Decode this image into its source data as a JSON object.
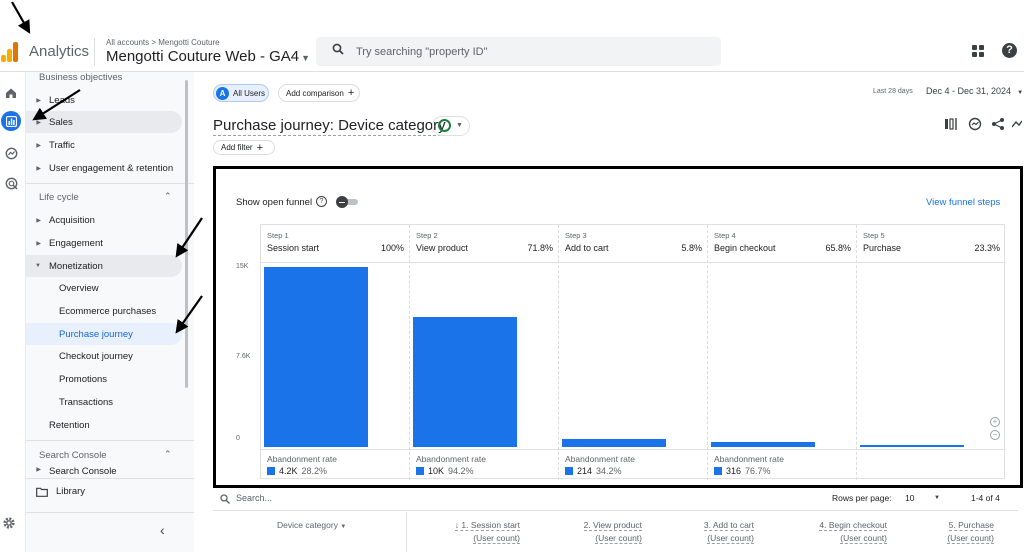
{
  "app": {
    "name": "Analytics",
    "breadcrumb": "All accounts > Mengotti Couture",
    "property": "Mengotti Couture Web - GA4"
  },
  "search": {
    "placeholder": "Try searching \"property ID\""
  },
  "sidebar": {
    "business_objectives": "Business objectives",
    "bo_items": [
      "Leads",
      "Sales",
      "Traffic",
      "User engagement & retention"
    ],
    "life_cycle": "Life cycle",
    "lc_items": [
      "Acquisition",
      "Engagement",
      "Monetization"
    ],
    "monetization_sub": [
      "Overview",
      "Ecommerce purchases",
      "Purchase journey",
      "Checkout journey",
      "Promotions",
      "Transactions"
    ],
    "retention": "Retention",
    "search_console": "Search Console",
    "search_console_sub": "Search Console",
    "library": "Library"
  },
  "toolbar": {
    "segment": "All Users",
    "segment_letter": "A",
    "add_comparison": "Add comparison",
    "date_label": "Last 28 days",
    "date_range": "Dec 4 - Dec 31, 2024"
  },
  "page": {
    "title": "Purchase journey: Device category",
    "add_filter": "Add filter"
  },
  "funnel": {
    "show_open_funnel": "Show open funnel",
    "view_steps": "View funnel steps",
    "abandonment_label": "Abandonment rate",
    "y_ticks": [
      "15K",
      "7.6K",
      "0"
    ]
  },
  "chart_data": {
    "type": "bar",
    "categories": [
      "Session start",
      "View product",
      "Add to cart",
      "Begin checkout",
      "Purchase"
    ],
    "step_labels": [
      "Step 1",
      "Step 2",
      "Step 3",
      "Step 4",
      "Step 5"
    ],
    "step_percents": [
      "100%",
      "71.8%",
      "5.8%",
      "65.8%",
      "23.3%"
    ],
    "values": [
      14900,
      10700,
      650,
      430,
      100
    ],
    "ylim": [
      0,
      15200
    ],
    "abandonment": [
      {
        "count": "4.2K",
        "rate": "28.2%"
      },
      {
        "count": "10K",
        "rate": "94.2%"
      },
      {
        "count": "214",
        "rate": "34.2%"
      },
      {
        "count": "316",
        "rate": "76.7%"
      }
    ]
  },
  "table": {
    "search_placeholder": "Search...",
    "rows_per_page_label": "Rows per page:",
    "rows_per_page": "10",
    "pager": "1-4 of 4",
    "dimension": "Device category",
    "columns": [
      {
        "name": "↓ 1. Session start",
        "sub": "(User count)"
      },
      {
        "name": "2. View product",
        "sub": "(User count)"
      },
      {
        "name": "3. Add to cart",
        "sub": "(User count)"
      },
      {
        "name": "4. Begin checkout",
        "sub": "(User count)"
      },
      {
        "name": "5. Purchase",
        "sub": "(User count)"
      }
    ]
  },
  "colors": {
    "accent": "#1a73e8",
    "bar": "#1a73e8",
    "logo_orange": "#f9ab00",
    "logo_dark": "#e37400"
  }
}
